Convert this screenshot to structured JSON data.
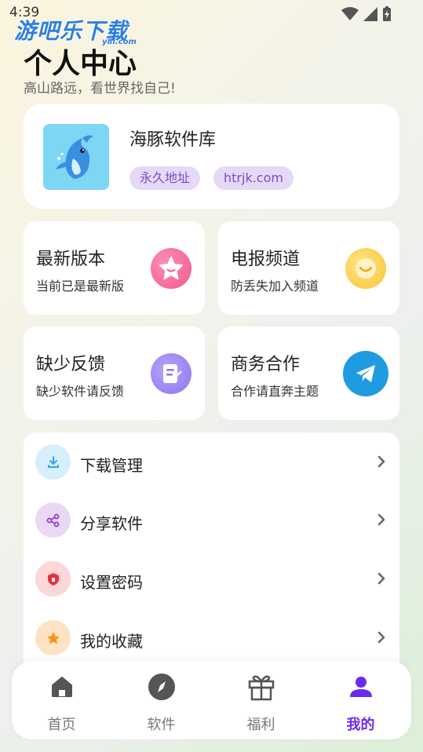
{
  "status": {
    "time": "4:39"
  },
  "watermark": {
    "text": "游吧乐下载",
    "sub": "y8l.com"
  },
  "header": {
    "title": "个人中心",
    "subtitle": "高山路远，看世界找自己!"
  },
  "profile": {
    "name": "海豚软件库",
    "tags": [
      "永久地址",
      "htrjk.com"
    ]
  },
  "quick_cards": [
    {
      "title": "最新版本",
      "subtitle": "当前已是最新版",
      "icon": "star-icon",
      "color": "#f5578f"
    },
    {
      "title": "电报频道",
      "subtitle": "防丢失加入频道",
      "icon": "chat-bubble-icon",
      "color": "#f7c531"
    },
    {
      "title": "缺少反馈",
      "subtitle": "缺少软件请反馈",
      "icon": "document-edit-icon",
      "color": "#8d74ef"
    },
    {
      "title": "商务合作",
      "subtitle": "合作请直奔主题",
      "icon": "telegram-icon",
      "color": "#1f9be0"
    }
  ],
  "menu": [
    {
      "label": "下载管理",
      "icon": "download-icon",
      "bg": "#d6effc",
      "fg": "#3aa3e3"
    },
    {
      "label": "分享软件",
      "icon": "share-icon",
      "bg": "#ead8f5",
      "fg": "#8a3fd1"
    },
    {
      "label": "设置密码",
      "icon": "shield-icon",
      "bg": "#fbd7d9",
      "fg": "#e8313e"
    },
    {
      "label": "我的收藏",
      "icon": "star-icon",
      "bg": "#fde3c4",
      "fg": "#f5951f"
    }
  ],
  "nav": [
    {
      "label": "首页",
      "icon": "home-icon",
      "active": false
    },
    {
      "label": "软件",
      "icon": "compass-icon",
      "active": false
    },
    {
      "label": "福利",
      "icon": "gift-icon",
      "active": false
    },
    {
      "label": "我的",
      "icon": "user-icon",
      "active": true
    }
  ],
  "colors": {
    "accent": "#6a2cf0",
    "tag_bg": "#e6d9f7",
    "tag_text": "#7a4dc9"
  }
}
